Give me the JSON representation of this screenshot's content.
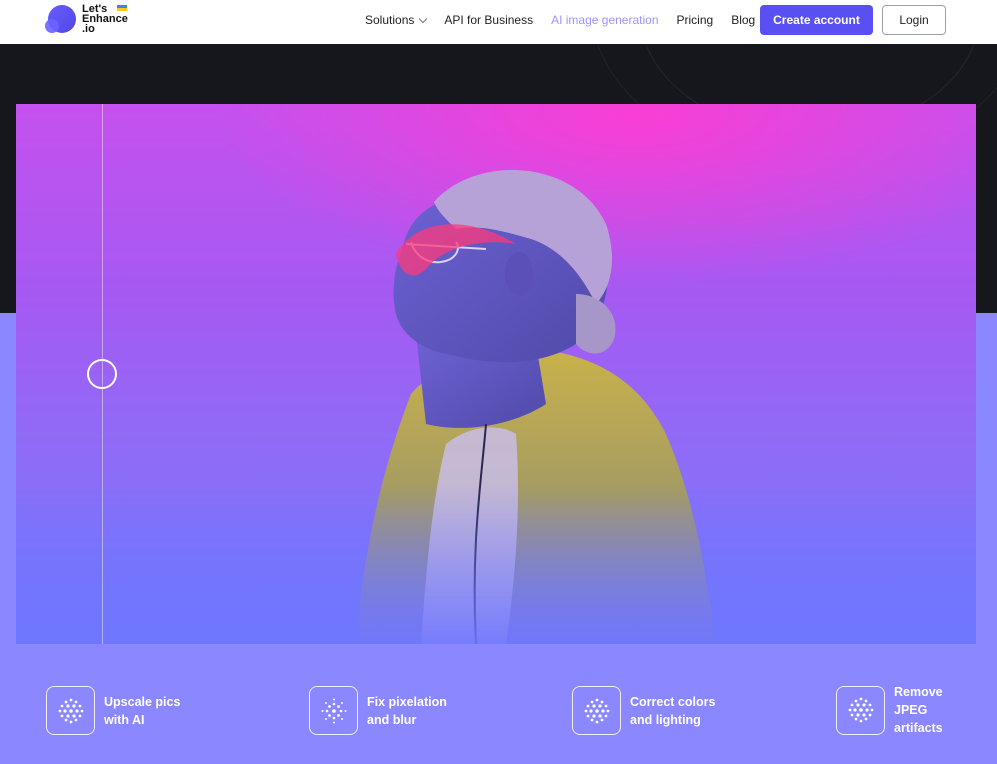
{
  "header": {
    "logo": {
      "line1": "Let's",
      "line2": "Enhance",
      "line3": ".io"
    },
    "nav": [
      {
        "label": "Solutions",
        "has_dropdown": true
      },
      {
        "label": "API for Business"
      },
      {
        "label": "AI image generation",
        "active": true
      },
      {
        "label": "Pricing"
      },
      {
        "label": "Blog"
      }
    ],
    "create_account_label": "Create account",
    "login_label": "Login"
  },
  "hero": {
    "comparison_slider_position": 0.09
  },
  "features": [
    {
      "icon": "dots-sphere-icon",
      "label_line1": "Upscale pics",
      "label_line2": "with AI"
    },
    {
      "icon": "dots-burst-icon",
      "label_line1": "Fix pixelation",
      "label_line2": "and blur"
    },
    {
      "icon": "dots-sphere-icon",
      "label_line1": "Correct colors",
      "label_line2": "and lighting"
    },
    {
      "icon": "dots-sphere-icon",
      "label_line1": "Remove",
      "label_line2": "JPEG",
      "label_line3": "artifacts"
    }
  ],
  "colors": {
    "brand": "#5a4ff3",
    "nav_active": "#9b95ff",
    "dark_band": "#16171c",
    "page_bg": "#8b87ff"
  }
}
